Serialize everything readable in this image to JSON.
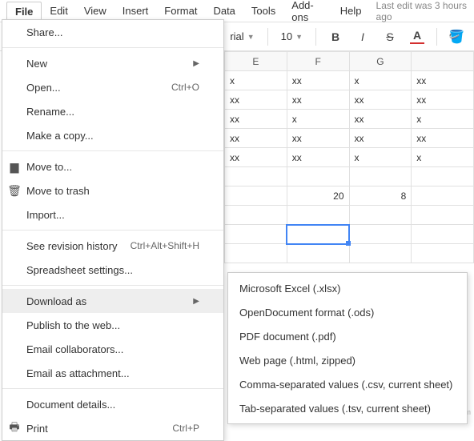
{
  "menubar": {
    "items": [
      "File",
      "Edit",
      "View",
      "Insert",
      "Format",
      "Data",
      "Tools",
      "Add-ons",
      "Help"
    ],
    "meta": "Last edit was 3 hours ago"
  },
  "toolbar": {
    "font_family": "rial",
    "font_size": "10",
    "bold": "B",
    "italic": "I",
    "strike": "S",
    "text_color": "A"
  },
  "sheet": {
    "cols": [
      "E",
      "F",
      "G",
      ""
    ],
    "rows": [
      [
        "x",
        "xx",
        "x",
        "xx"
      ],
      [
        "xx",
        "xx",
        "xx",
        "xx"
      ],
      [
        "xx",
        "x",
        "xx",
        "x"
      ],
      [
        "xx",
        "xx",
        "xx",
        "xx"
      ],
      [
        "xx",
        "xx",
        "x",
        "x"
      ],
      [
        "",
        "",
        "",
        ""
      ],
      [
        "",
        "20",
        "8",
        ""
      ],
      [
        "",
        "",
        "",
        ""
      ],
      [
        "",
        "",
        "",
        ""
      ],
      [
        "",
        "",
        "",
        ""
      ]
    ],
    "selected_row": 8,
    "selected_col": 1
  },
  "file_menu": {
    "items": [
      {
        "label": "Share...",
        "type": "item"
      },
      {
        "type": "sep"
      },
      {
        "label": "New",
        "type": "submenu"
      },
      {
        "label": "Open...",
        "shortcut": "Ctrl+O",
        "type": "item"
      },
      {
        "label": "Rename...",
        "type": "item"
      },
      {
        "label": "Make a copy...",
        "type": "item"
      },
      {
        "type": "sep"
      },
      {
        "label": "Move to...",
        "icon": "folder",
        "type": "item"
      },
      {
        "label": "Move to trash",
        "icon": "trash",
        "type": "item"
      },
      {
        "label": "Import...",
        "type": "item"
      },
      {
        "type": "sep"
      },
      {
        "label": "See revision history",
        "shortcut": "Ctrl+Alt+Shift+H",
        "type": "item"
      },
      {
        "label": "Spreadsheet settings...",
        "type": "item"
      },
      {
        "type": "sep"
      },
      {
        "label": "Download as",
        "type": "submenu",
        "hl": true
      },
      {
        "label": "Publish to the web...",
        "type": "item"
      },
      {
        "label": "Email collaborators...",
        "type": "item"
      },
      {
        "label": "Email as attachment...",
        "type": "item"
      },
      {
        "type": "sep"
      },
      {
        "label": "Document details...",
        "type": "item"
      },
      {
        "label": "Print",
        "shortcut": "Ctrl+P",
        "icon": "print",
        "type": "item"
      }
    ]
  },
  "download_submenu": {
    "items": [
      "Microsoft Excel (.xlsx)",
      "OpenDocument format (.ods)",
      "PDF document (.pdf)",
      "Web page (.html, zipped)",
      "Comma-separated values (.csv, current sheet)",
      "Tab-separated values (.tsv, current sheet)"
    ]
  },
  "watermark": "www.deuaq.com"
}
